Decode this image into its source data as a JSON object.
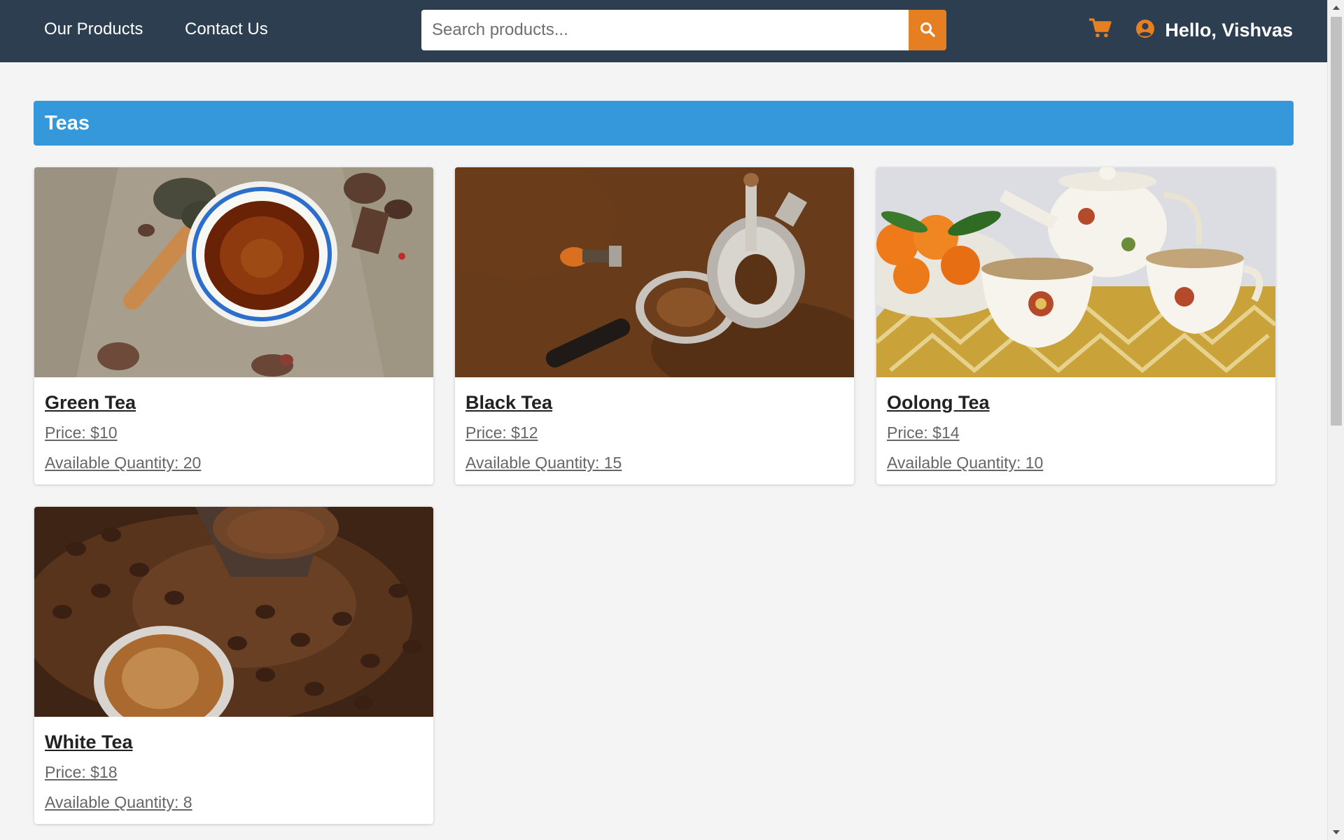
{
  "nav": {
    "products_label": "Our Products",
    "contact_label": "Contact Us",
    "greeting": "Hello, Vishvas",
    "cart_icon": "shopping-cart-icon",
    "user_icon": "user-circle-icon",
    "accent_color": "#e67e22",
    "background_color": "#2c3e50"
  },
  "search": {
    "placeholder": "Search products...",
    "value": "",
    "button_icon": "search-icon"
  },
  "category": {
    "title": "Teas",
    "color": "#3498db"
  },
  "products": [
    {
      "name": "Green Tea",
      "price": "Price: $10",
      "quantity": "Available Quantity: 20",
      "image": "cup of dark tea on burlap with wooden spoon of loose leaves"
    },
    {
      "name": "Black Tea",
      "price": "Price: $12",
      "quantity": "Available Quantity: 15",
      "image": "coffee grinder and portafilter on roasted beans"
    },
    {
      "name": "Oolong Tea",
      "price": "Price: $14",
      "quantity": "Available Quantity: 10",
      "image": "floral porcelain teapot and cups with bowl of mandarins"
    },
    {
      "name": "White Tea",
      "price": "Price: $18",
      "quantity": "Available Quantity: 8",
      "image": "cup of coffee with beans and grinder on wooden table"
    }
  ]
}
